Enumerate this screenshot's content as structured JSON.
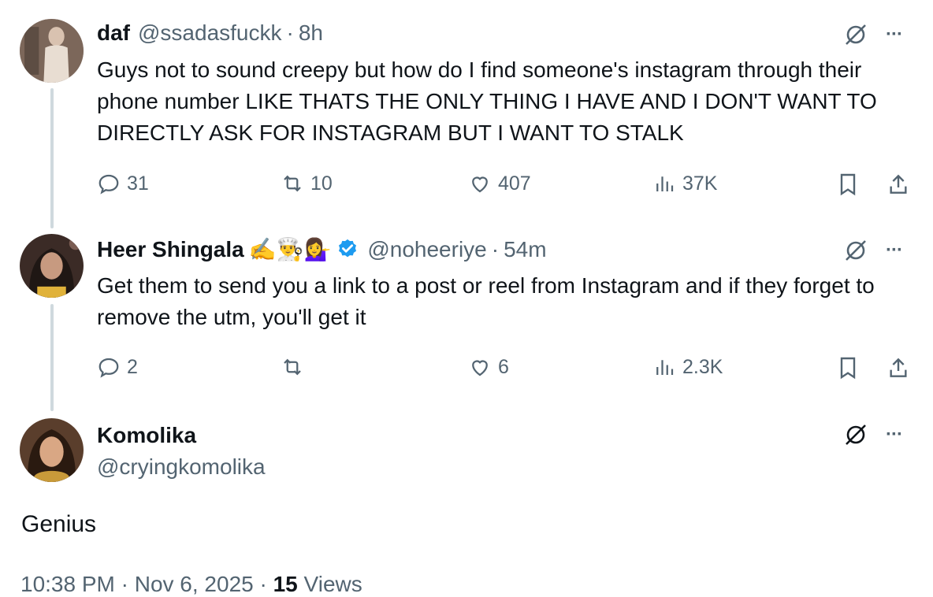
{
  "tweets": [
    {
      "name": "daf",
      "handle": "@ssadasfuckk",
      "time": "8h",
      "text": "Guys not to sound creepy but how do I find someone's instagram through their phone number LIKE THATS THE ONLY THING I HAVE AND I DON'T WANT TO DIRECTLY ASK FOR INSTAGRAM BUT I WANT TO STALK",
      "replies": "31",
      "reposts": "10",
      "likes": "407",
      "views": "37K"
    },
    {
      "name": "Heer Shingala",
      "name_emojis": "✍️👨‍🍳💁‍♀️",
      "handle": "@noheeriye",
      "time": "54m",
      "text": "Get them to send you a link to a post or reel from Instagram and if they forget to remove the utm, you'll get it",
      "replies": "2",
      "reposts": "",
      "likes": "6",
      "views": "2.3K"
    }
  ],
  "main_tweet": {
    "name": "Komolika",
    "handle": "@cryingkomolika",
    "text": "Genius",
    "timestamp": "10:38 PM · Nov 6, 2025 ·",
    "views_count": "15",
    "views_label": "Views"
  },
  "ui": {
    "more_label": "···",
    "dot": "·"
  },
  "colors": {
    "text": "#0f1419",
    "secondary": "#536471",
    "thread_line": "#cfd9de",
    "verified": "#1d9bf0"
  },
  "icons": [
    "reply-icon",
    "repost-icon",
    "like-icon",
    "views-icon",
    "bookmark-icon",
    "share-icon",
    "grok-icon",
    "more-icon",
    "verified-icon"
  ]
}
